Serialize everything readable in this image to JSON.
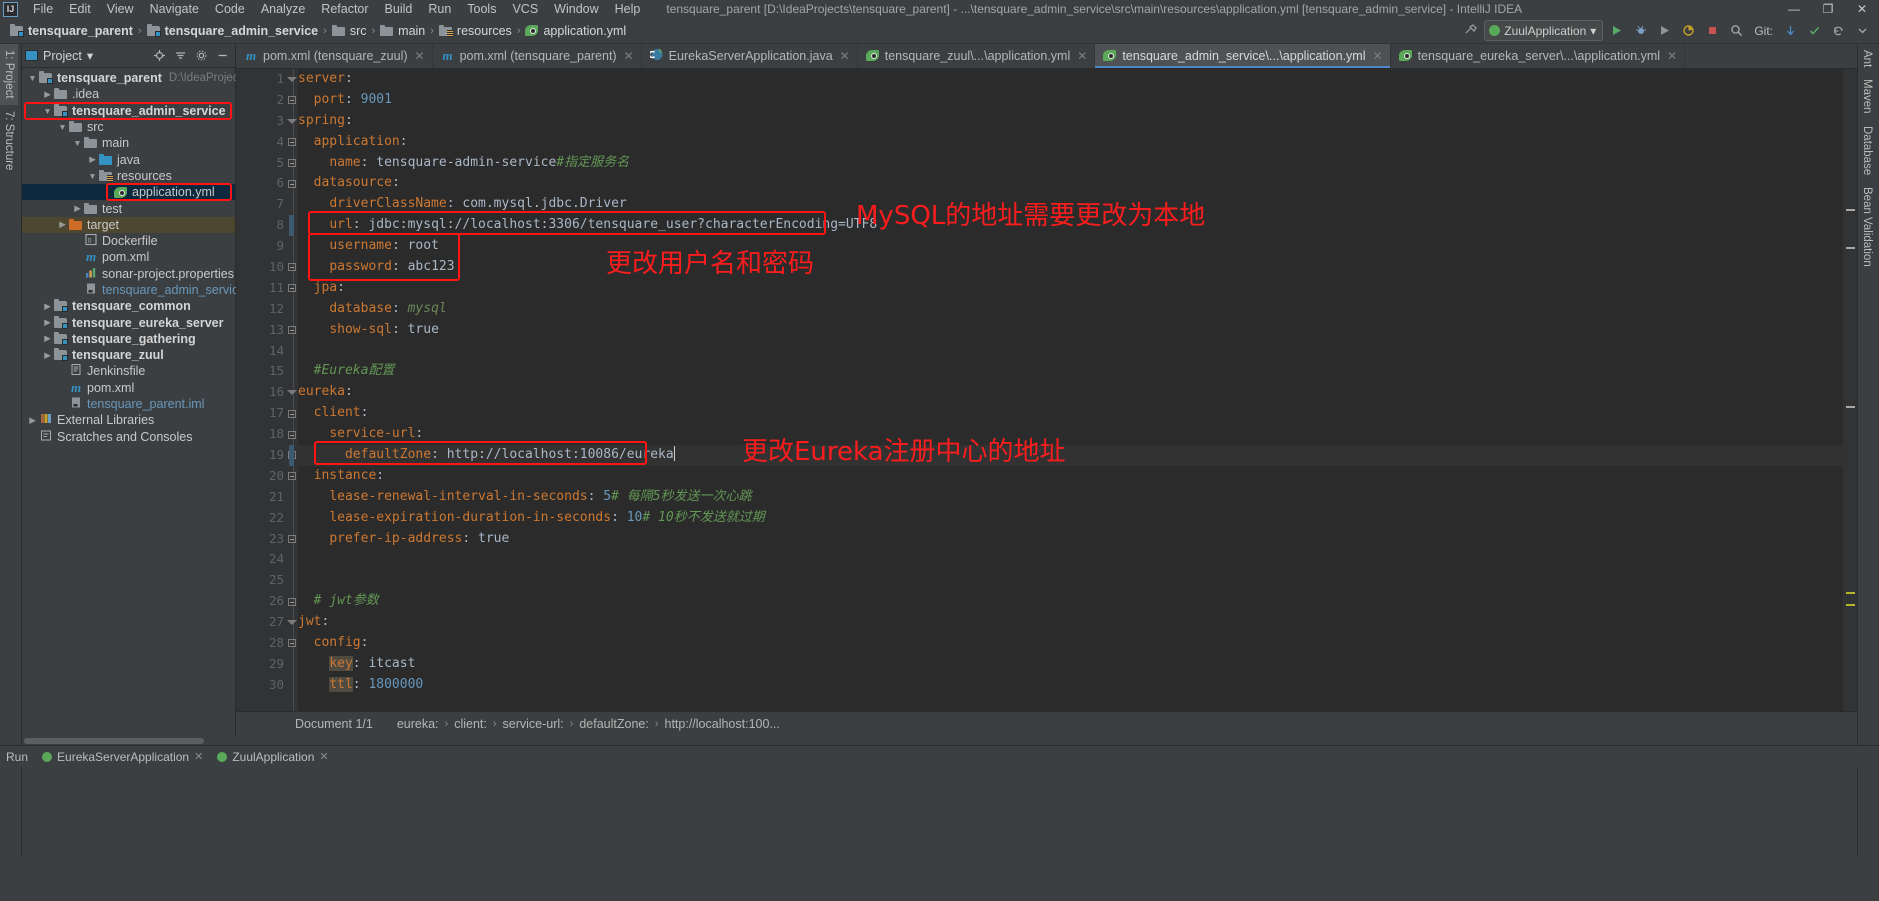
{
  "window": {
    "title": "tensquare_parent [D:\\IdeaProjects\\tensquare_parent] - ...\\tensquare_admin_service\\src\\main\\resources\\application.yml [tensquare_admin_service] - IntelliJ IDEA",
    "logo": "IJ",
    "minimize": "—",
    "maximize": "❐",
    "close": "✕"
  },
  "menubar": [
    {
      "label": "File"
    },
    {
      "label": "Edit"
    },
    {
      "label": "View"
    },
    {
      "label": "Navigate"
    },
    {
      "label": "Code"
    },
    {
      "label": "Analyze"
    },
    {
      "label": "Refactor"
    },
    {
      "label": "Build"
    },
    {
      "label": "Run"
    },
    {
      "label": "Tools"
    },
    {
      "label": "VCS"
    },
    {
      "label": "Window"
    },
    {
      "label": "Help"
    }
  ],
  "breadcrumb": {
    "items": [
      {
        "label": "tensquare_parent",
        "icon": "module-icon",
        "bold": true
      },
      {
        "label": "tensquare_admin_service",
        "icon": "module-icon",
        "bold": true
      },
      {
        "label": "src",
        "icon": "folder-icon",
        "bold": false
      },
      {
        "label": "main",
        "icon": "folder-icon",
        "bold": false
      },
      {
        "label": "resources",
        "icon": "resources-folder-icon",
        "bold": false
      },
      {
        "label": "application.yml",
        "icon": "yaml-file-icon",
        "bold": false
      }
    ],
    "separator": "›"
  },
  "toolbar": {
    "run_config": "ZuulApplication",
    "run_config_caret": "▾",
    "git_label": "Git:",
    "buttons": [
      {
        "name": "build-project-icon",
        "glyph": "⚒"
      },
      {
        "name": "run-icon",
        "glyph": "▶"
      },
      {
        "name": "debug-icon",
        "glyph": "❆"
      },
      {
        "name": "run-with-coverage-icon",
        "glyph": "▣"
      },
      {
        "name": "profile-icon",
        "glyph": "◔"
      },
      {
        "name": "stop-icon",
        "glyph": "■"
      },
      {
        "name": "update-project-icon",
        "glyph": "↓"
      },
      {
        "name": "commit-icon",
        "glyph": "✓"
      },
      {
        "name": "rollback-icon",
        "glyph": "↺"
      },
      {
        "name": "search-everywhere-icon",
        "glyph": "⌕"
      }
    ]
  },
  "left_stripe": [
    {
      "label": "1: Project",
      "name": "tool-window-project",
      "active": true
    },
    {
      "label": "7: Structure",
      "name": "tool-window-structure",
      "active": false
    }
  ],
  "right_stripe": [
    {
      "label": "Ant",
      "name": "tool-window-ant"
    },
    {
      "label": "Maven",
      "name": "tool-window-maven"
    },
    {
      "label": "Database",
      "name": "tool-window-database"
    },
    {
      "label": "Bean Validation",
      "name": "tool-window-bean-validation"
    }
  ],
  "bottom_stripe": [
    {
      "label": "Run",
      "name": "tool-window-run"
    },
    {
      "label": "EurekaServerApplication",
      "name": "run-tab-eureka"
    },
    {
      "label": "ZuulApplication",
      "name": "run-tab-zuul"
    }
  ],
  "project_panel": {
    "title": "Project",
    "title_caret": "▾",
    "actions": [
      {
        "name": "locate-icon",
        "glyph": "⊕"
      },
      {
        "name": "collapse-all-icon",
        "glyph": "≡"
      },
      {
        "name": "settings-icon",
        "glyph": "⚙"
      },
      {
        "name": "hide-icon",
        "glyph": "—"
      }
    ],
    "tree": [
      {
        "label": "tensquare_parent",
        "sub": "D:\\IdeaProjects\\ten",
        "indent": 0,
        "arrow": "▼",
        "icon": "module-icon",
        "bold": true,
        "state": "none"
      },
      {
        "label": ".idea",
        "sub": "",
        "indent": 1,
        "arrow": "▶",
        "icon": "folder-icon",
        "bold": false,
        "state": "none"
      },
      {
        "label": "tensquare_admin_service",
        "sub": "",
        "indent": 1,
        "arrow": "▼",
        "icon": "module-icon",
        "bold": true,
        "state": "boxed"
      },
      {
        "label": "src",
        "sub": "",
        "indent": 2,
        "arrow": "▼",
        "icon": "folder-icon",
        "bold": false,
        "state": "none"
      },
      {
        "label": "main",
        "sub": "",
        "indent": 3,
        "arrow": "▼",
        "icon": "folder-icon",
        "bold": false,
        "state": "none"
      },
      {
        "label": "java",
        "sub": "",
        "indent": 4,
        "arrow": "▶",
        "icon": "source-folder-icon",
        "bold": false,
        "state": "none"
      },
      {
        "label": "resources",
        "sub": "",
        "indent": 4,
        "arrow": "▼",
        "icon": "resources-folder-icon",
        "bold": false,
        "state": "none"
      },
      {
        "label": "application.yml",
        "sub": "",
        "indent": 5,
        "arrow": "",
        "icon": "yaml-file-icon",
        "bold": false,
        "state": "selected"
      },
      {
        "label": "test",
        "sub": "",
        "indent": 3,
        "arrow": "▶",
        "icon": "folder-icon",
        "bold": false,
        "state": "none"
      },
      {
        "label": "target",
        "sub": "",
        "indent": 2,
        "arrow": "▶",
        "icon": "target-folder-icon",
        "bold": false,
        "state": "olive"
      },
      {
        "label": "Dockerfile",
        "sub": "",
        "indent": 3,
        "arrow": "",
        "icon": "docker-file-icon",
        "bold": false,
        "state": "none"
      },
      {
        "label": "pom.xml",
        "sub": "",
        "indent": 3,
        "arrow": "",
        "icon": "maven-file-icon",
        "bold": false,
        "state": "none"
      },
      {
        "label": "sonar-project.properties",
        "sub": "",
        "indent": 3,
        "arrow": "",
        "icon": "sonar-file-icon",
        "bold": false,
        "state": "none"
      },
      {
        "label": "tensquare_admin_service.iml",
        "sub": "",
        "indent": 3,
        "arrow": "",
        "icon": "iml-file-icon",
        "bold": false,
        "state": "link"
      },
      {
        "label": "tensquare_common",
        "sub": "",
        "indent": 1,
        "arrow": "▶",
        "icon": "module-icon",
        "bold": true,
        "state": "none"
      },
      {
        "label": "tensquare_eureka_server",
        "sub": "",
        "indent": 1,
        "arrow": "▶",
        "icon": "module-icon",
        "bold": true,
        "state": "none"
      },
      {
        "label": "tensquare_gathering",
        "sub": "",
        "indent": 1,
        "arrow": "▶",
        "icon": "module-icon",
        "bold": true,
        "state": "none"
      },
      {
        "label": "tensquare_zuul",
        "sub": "",
        "indent": 1,
        "arrow": "▶",
        "icon": "module-icon",
        "bold": true,
        "state": "none"
      },
      {
        "label": "Jenkinsfile",
        "sub": "",
        "indent": 2,
        "arrow": "",
        "icon": "jenkins-file-icon",
        "bold": false,
        "state": "none"
      },
      {
        "label": "pom.xml",
        "sub": "",
        "indent": 2,
        "arrow": "",
        "icon": "maven-file-icon",
        "bold": false,
        "state": "none"
      },
      {
        "label": "tensquare_parent.iml",
        "sub": "",
        "indent": 2,
        "arrow": "",
        "icon": "iml-file-icon",
        "bold": false,
        "state": "link"
      },
      {
        "label": "External Libraries",
        "sub": "",
        "indent": 0,
        "arrow": "▶",
        "icon": "library-icon",
        "bold": false,
        "state": "none"
      },
      {
        "label": "Scratches and Consoles",
        "sub": "",
        "indent": 0,
        "arrow": "",
        "icon": "scratches-icon",
        "bold": false,
        "state": "none"
      }
    ]
  },
  "editor_tabs": [
    {
      "label": "pom.xml (tensquare_zuul)",
      "icon": "maven-file-icon",
      "active": false,
      "close": "✕"
    },
    {
      "label": "pom.xml (tensquare_parent)",
      "icon": "maven-file-icon",
      "active": false,
      "close": "✕"
    },
    {
      "label": "EurekaServerApplication.java",
      "icon": "java-class-icon",
      "active": false,
      "close": "✕"
    },
    {
      "label": "tensquare_zuul\\...\\application.yml",
      "icon": "yaml-file-icon",
      "active": false,
      "close": "✕"
    },
    {
      "label": "tensquare_admin_service\\...\\application.yml",
      "icon": "yaml-file-icon",
      "active": true,
      "close": "✕"
    },
    {
      "label": "tensquare_eureka_server\\...\\application.yml",
      "icon": "yaml-file-icon",
      "active": false,
      "close": "✕"
    }
  ],
  "code": {
    "language": "yaml",
    "lines": [
      {
        "n": 1,
        "fold": "top",
        "text": "server:"
      },
      {
        "n": 2,
        "fold": "end",
        "text": "  port: 9001"
      },
      {
        "n": 3,
        "fold": "top",
        "text": "spring:"
      },
      {
        "n": 4,
        "fold": "mid",
        "text": "  application:"
      },
      {
        "n": 5,
        "fold": "end",
        "text": "    name: tensquare-admin-service #指定服务名"
      },
      {
        "n": 6,
        "fold": "mid",
        "text": "  datasource:"
      },
      {
        "n": 7,
        "fold": "",
        "text": "    driverClassName: com.mysql.jdbc.Driver"
      },
      {
        "n": 8,
        "fold": "",
        "text": "    url: jdbc:mysql://localhost:3306/tensquare_user?characterEncoding=UTF8"
      },
      {
        "n": 9,
        "fold": "",
        "text": "    username: root"
      },
      {
        "n": 10,
        "fold": "end",
        "text": "    password: abc123"
      },
      {
        "n": 11,
        "fold": "mid",
        "text": "  jpa:"
      },
      {
        "n": 12,
        "fold": "",
        "text": "    database: mysql"
      },
      {
        "n": 13,
        "fold": "end",
        "text": "    show-sql: true"
      },
      {
        "n": 14,
        "fold": "",
        "text": ""
      },
      {
        "n": 15,
        "fold": "",
        "text": "  #Eureka配置"
      },
      {
        "n": 16,
        "fold": "top",
        "text": "eureka:"
      },
      {
        "n": 17,
        "fold": "mid",
        "text": "  client:"
      },
      {
        "n": 18,
        "fold": "mid",
        "text": "    service-url:"
      },
      {
        "n": 19,
        "fold": "end",
        "text": "      defaultZone: http://localhost:10086/eureka"
      },
      {
        "n": 20,
        "fold": "mid",
        "text": "  instance:"
      },
      {
        "n": 21,
        "fold": "",
        "text": "    lease-renewal-interval-in-seconds: 5 # 每隔5秒发送一次心跳"
      },
      {
        "n": 22,
        "fold": "",
        "text": "    lease-expiration-duration-in-seconds: 10 # 10秒不发送就过期"
      },
      {
        "n": 23,
        "fold": "end",
        "text": "    prefer-ip-address: true"
      },
      {
        "n": 24,
        "fold": "",
        "text": ""
      },
      {
        "n": 25,
        "fold": "",
        "text": ""
      },
      {
        "n": 26,
        "fold": "end",
        "text": "  # jwt参数"
      },
      {
        "n": 27,
        "fold": "top",
        "text": "jwt:"
      },
      {
        "n": 28,
        "fold": "mid",
        "text": "  config:"
      },
      {
        "n": 29,
        "fold": "",
        "text": "    key: itcast"
      },
      {
        "n": 30,
        "fold": "",
        "text": "    ttl: 1800000"
      }
    ],
    "cursor_line": 19,
    "cursor_col_text": "      defaultZone: http://localhost:10086/eureka"
  },
  "annotations": [
    {
      "text": "MySQL的地址需要更改为本地",
      "name": "annotation-mysql-address",
      "color": "#fb1d1d"
    },
    {
      "text": "更改用户名和密码",
      "name": "annotation-credentials",
      "color": "#fb1d1d"
    },
    {
      "text": "更改Eureka注册中心的地址",
      "name": "annotation-eureka-address",
      "color": "#fb1d1d"
    }
  ],
  "editor_breadcrumbs": {
    "document": "Document 1/1",
    "path": [
      "eureka:",
      "client:",
      "service-url:",
      "defaultZone:",
      "http://localhost:100..."
    ],
    "separator": "›"
  }
}
